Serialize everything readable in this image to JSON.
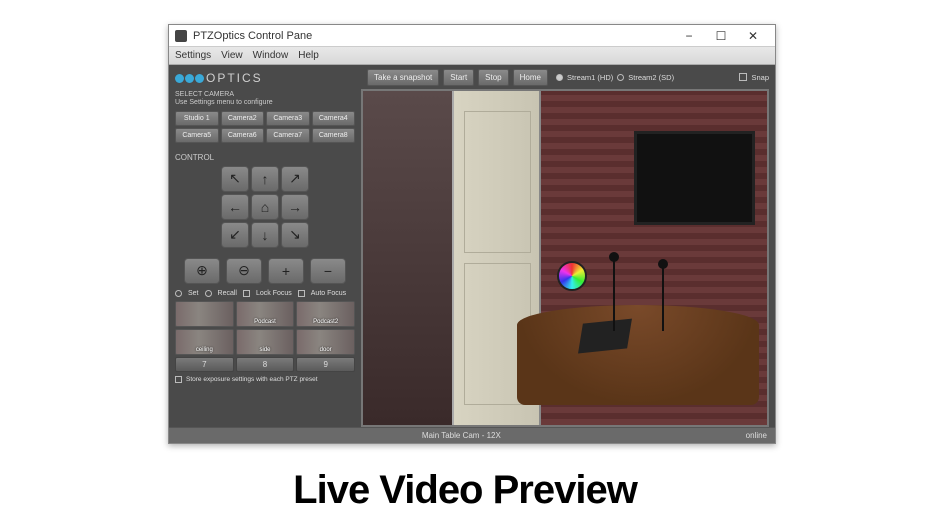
{
  "caption": "Live Video Preview",
  "window": {
    "title": "PTZOptics Control Pane"
  },
  "menu": {
    "settings": "Settings",
    "view": "View",
    "window": "Window",
    "help": "Help"
  },
  "logo": {
    "text": "OPTICS"
  },
  "select_camera": {
    "label1": "SELECT CAMERA",
    "label2": "Use Settings menu to configure",
    "buttons": [
      "Studio 1",
      "Camera2",
      "Camera3",
      "Camera4",
      "Camera5",
      "Camera6",
      "Camera7",
      "Camera8"
    ]
  },
  "control_label": "CONTROL",
  "focus_row": {
    "set": "Set",
    "recall": "Recall",
    "lock": "Lock Focus",
    "auto": "Auto Focus"
  },
  "presets": {
    "thumbs": [
      "",
      "Podcast",
      "Podcast2",
      "ceiling",
      "side",
      "door"
    ],
    "nums": [
      "7",
      "8",
      "9"
    ]
  },
  "store_label": "Store exposure settings with each PTZ preset",
  "top": {
    "snapshot": "Take a snapshot",
    "start": "Start",
    "stop": "Stop",
    "home": "Home",
    "stream1": "Stream1 (HD)",
    "stream2": "Stream2 (SD)",
    "snap": "Snap"
  },
  "status": {
    "center": "Main Table Cam - 12X",
    "right": "online"
  }
}
